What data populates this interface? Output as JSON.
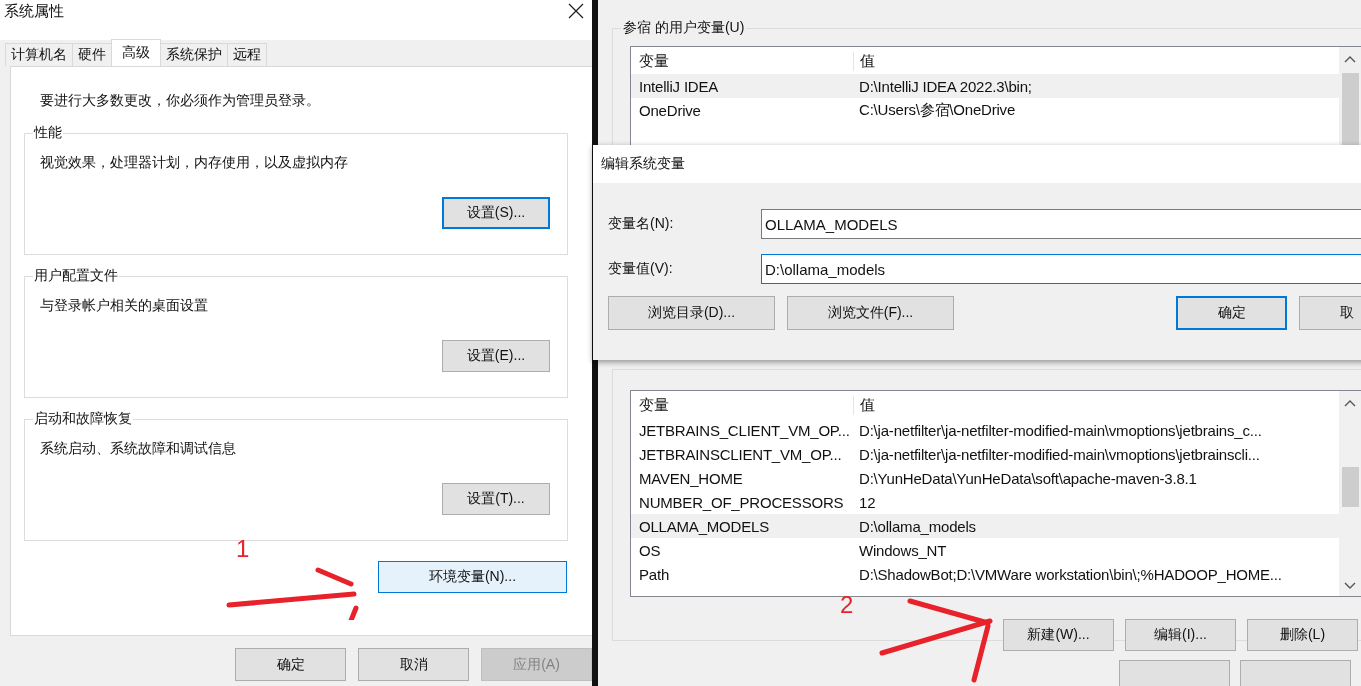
{
  "system_properties": {
    "title": "系统属性",
    "tabs": [
      {
        "label": "计算机名",
        "selected": false
      },
      {
        "label": "硬件",
        "selected": false
      },
      {
        "label": "高级",
        "selected": true
      },
      {
        "label": "系统保护",
        "selected": false
      },
      {
        "label": "远程",
        "selected": false
      }
    ],
    "notice": "要进行大多数更改，你必须作为管理员登录。",
    "groups": [
      {
        "title": "性能",
        "description": "视觉效果，处理器计划，内存使用，以及虚拟内存",
        "button": {
          "label": "设置(S)...",
          "kind": "focused"
        }
      },
      {
        "title": "用户配置文件",
        "description": "与登录帐户相关的桌面设置",
        "button": {
          "label": "设置(E)...",
          "kind": "normal"
        }
      },
      {
        "title": "启动和故障恢复",
        "description": "系统启动、系统故障和调试信息",
        "button": {
          "label": "设置(T)...",
          "kind": "normal"
        }
      }
    ],
    "env_button": {
      "label": "环境变量(N)...",
      "kind": "hovered"
    },
    "footer_buttons": [
      {
        "label": "确定",
        "kind": "normal"
      },
      {
        "label": "取消",
        "kind": "normal"
      },
      {
        "label": "应用(A)",
        "kind": "disabled"
      }
    ]
  },
  "environment_variables": {
    "user_group_title": "参宿 的用户变量(U)",
    "user_table": {
      "columns": [
        "变量",
        "值"
      ],
      "rows": [
        {
          "name": "IntelliJ IDEA",
          "value": "D:\\IntelliJ IDEA 2022.3\\bin;",
          "selected": true
        },
        {
          "name": "OneDrive",
          "value": "C:\\Users\\参宿\\OneDrive",
          "selected": false
        }
      ]
    },
    "system_table": {
      "columns": [
        "变量",
        "值"
      ],
      "rows": [
        {
          "name": "JETBRAINS_CLIENT_VM_OP...",
          "value": "D:\\ja-netfilter\\ja-netfilter-modified-main\\vmoptions\\jetbrains_c...",
          "selected": false
        },
        {
          "name": "JETBRAINSCLIENT_VM_OP...",
          "value": "D:\\ja-netfilter\\ja-netfilter-modified-main\\vmoptions\\jetbrainscli...",
          "selected": false
        },
        {
          "name": "MAVEN_HOME",
          "value": "D:\\YunHeData\\YunHeData\\soft\\apache-maven-3.8.1",
          "selected": false
        },
        {
          "name": "NUMBER_OF_PROCESSORS",
          "value": "12",
          "selected": false
        },
        {
          "name": "OLLAMA_MODELS",
          "value": "D:\\ollama_models",
          "selected": true
        },
        {
          "name": "OS",
          "value": "Windows_NT",
          "selected": false
        },
        {
          "name": "Path",
          "value": "D:\\ShadowBot;D:\\VMWare workstation\\bin\\;%HADOOP_HOME...",
          "selected": false
        }
      ]
    },
    "system_buttons": [
      {
        "label": "新建(W)...",
        "kind": "normal"
      },
      {
        "label": "编辑(I)...",
        "kind": "normal"
      },
      {
        "label": "删除(L)",
        "kind": "normal"
      }
    ]
  },
  "edit_dialog": {
    "title": "编辑系统变量",
    "fields": [
      {
        "label": "变量名(N):",
        "value": "OLLAMA_MODELS",
        "focused": false
      },
      {
        "label": "变量值(V):",
        "value": "D:\\ollama_models",
        "focused": true
      }
    ],
    "browse_buttons": [
      {
        "label": "浏览目录(D)...",
        "kind": "normal"
      },
      {
        "label": "浏览文件(F)...",
        "kind": "normal"
      }
    ],
    "action_buttons": [
      {
        "label": "确定",
        "kind": "focused"
      },
      {
        "label": "取",
        "kind": "normal"
      }
    ]
  },
  "annotations": [
    {
      "label": "1"
    },
    {
      "label": "2"
    }
  ]
}
